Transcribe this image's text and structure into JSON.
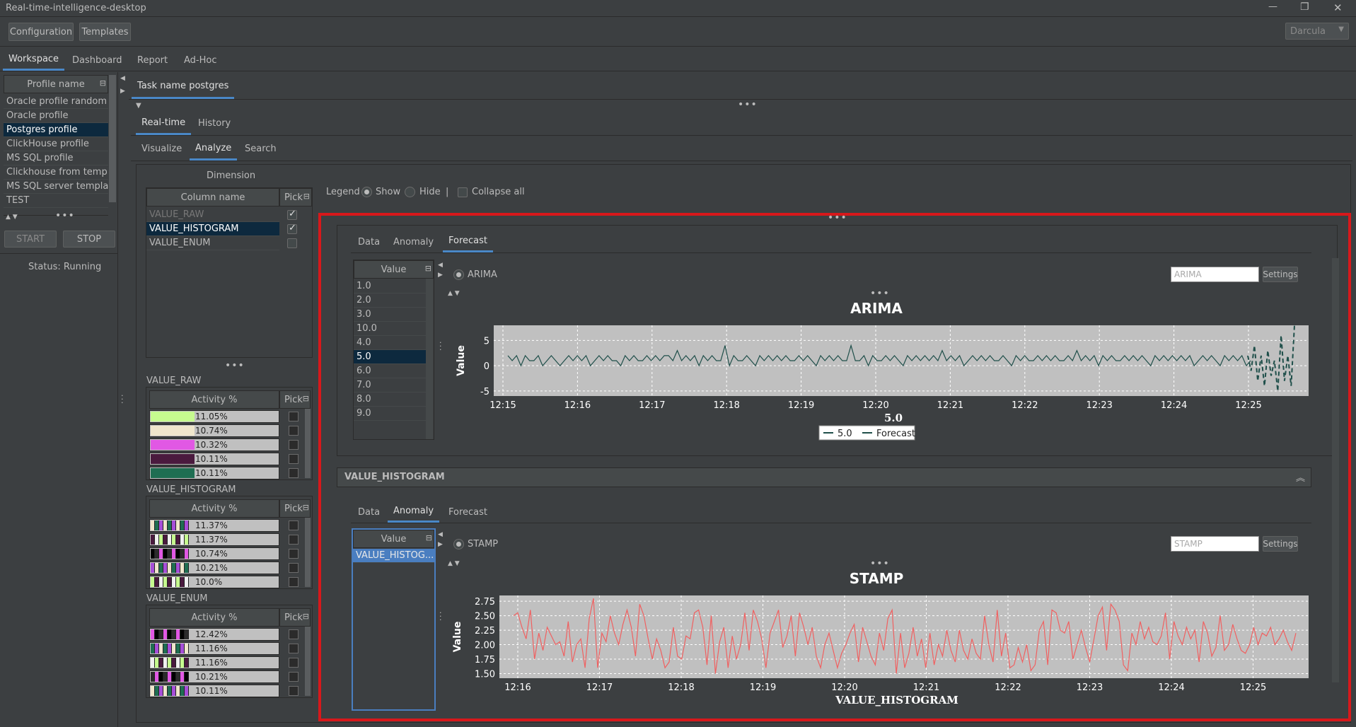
{
  "window": {
    "title": "Real-time-intelligence-desktop",
    "min": "—",
    "restore": "❐",
    "close": "✕"
  },
  "toolbar": {
    "configuration": "Configuration",
    "templates": "Templates",
    "theme": "Darcula"
  },
  "main_tabs": [
    "Workspace",
    "Dashboard",
    "Report",
    "Ad-Hoc"
  ],
  "profiles": {
    "header": "Profile name",
    "items": [
      "Oracle profile random",
      "Oracle profile",
      "Postgres profile",
      "ClickHouse profile",
      "MS SQL profile",
      "Clickhouse from templ...",
      "MS SQL server template",
      "TEST"
    ],
    "selected": 2,
    "start": "START",
    "stop": "STOP",
    "status": "Status: Running"
  },
  "task": {
    "tab": "Task name postgres",
    "mode_tabs": [
      "Real-time",
      "History"
    ],
    "sub_tabs": [
      "Visualize",
      "Analyze",
      "Search"
    ]
  },
  "dimension": {
    "title": "Dimension",
    "col_header": "Column name",
    "pick_header": "Pick",
    "columns": [
      {
        "name": "VALUE_RAW",
        "checked": true
      },
      {
        "name": "VALUE_HISTOGRAM",
        "checked": true
      },
      {
        "name": "VALUE_ENUM",
        "checked": false
      }
    ]
  },
  "activity_groups": [
    {
      "title": "VALUE_RAW",
      "header": "Activity %",
      "pick": "Pick",
      "rows": [
        {
          "pct": "11.05%",
          "color": "#c6fb8f"
        },
        {
          "pct": "10.74%",
          "color": "#efe6cc"
        },
        {
          "pct": "10.32%",
          "color": "#e158e4"
        },
        {
          "pct": "10.11%",
          "color": "#4a1a3e"
        },
        {
          "pct": "10.11%",
          "color": "#1f6e52"
        }
      ]
    },
    {
      "title": "VALUE_HISTOGRAM",
      "header": "Activity %",
      "pick": "Pick",
      "rows": [
        {
          "pct": "11.37%"
        },
        {
          "pct": "11.37%"
        },
        {
          "pct": "10.74%"
        },
        {
          "pct": "10.21%"
        },
        {
          "pct": "10.0%"
        }
      ]
    },
    {
      "title": "VALUE_ENUM",
      "header": "Activity %",
      "pick": "Pick",
      "rows": [
        {
          "pct": "12.42%"
        },
        {
          "pct": "11.16%"
        },
        {
          "pct": "11.16%"
        },
        {
          "pct": "10.21%"
        },
        {
          "pct": "10.11%"
        }
      ]
    }
  ],
  "legend": {
    "label": "Legend",
    "show": "Show",
    "hide": "Hide",
    "sep": "|",
    "collapse": "Collapse all"
  },
  "panel1": {
    "tabs": [
      "Data",
      "Anomaly",
      "Forecast"
    ],
    "active": 2,
    "value_header": "Value",
    "values": [
      "1.0",
      "2.0",
      "3.0",
      "10.0",
      "4.0",
      "5.0",
      "6.0",
      "7.0",
      "8.0",
      "9.0"
    ],
    "selected": 5,
    "method": "ARIMA",
    "input_placeholder": "ARIMA",
    "settings": "Settings"
  },
  "panel2": {
    "title": "VALUE_HISTOGRAM",
    "tabs": [
      "Data",
      "Anomaly",
      "Forecast"
    ],
    "active": 1,
    "value_header": "Value",
    "values": [
      "VALUE_HISTOG..."
    ],
    "method": "STAMP",
    "input_placeholder": "STAMP",
    "settings": "Settings"
  },
  "chart_data": [
    {
      "type": "line",
      "title": "ARIMA",
      "xlabel": "5.0",
      "ylabel": "Value",
      "x_ticks": [
        "12:15",
        "12:16",
        "12:17",
        "12:18",
        "12:19",
        "12:20",
        "12:21",
        "12:22",
        "12:23",
        "12:24",
        "12:25"
      ],
      "y_ticks": [
        "5",
        "0",
        "-5"
      ],
      "ylim": [
        -6,
        8
      ],
      "grid": true,
      "legend_position": "bottom",
      "series": [
        {
          "name": "5.0",
          "color": "#1f4f4a",
          "style": "solid",
          "values": [
            2,
            1,
            2,
            0,
            2,
            1,
            1,
            2,
            0,
            1,
            2,
            1,
            0,
            1,
            2,
            1,
            2,
            1,
            2,
            0,
            1,
            2,
            1,
            2,
            1,
            1,
            0,
            2,
            1,
            2,
            1,
            1,
            2,
            1,
            2,
            1,
            2,
            2,
            1,
            3,
            1,
            2,
            1,
            2,
            0,
            2,
            1,
            2,
            1,
            1,
            4,
            0,
            2,
            1,
            1,
            2,
            1,
            0,
            2,
            1,
            2,
            1,
            2,
            1,
            2,
            1,
            1,
            2,
            1,
            2,
            1,
            0,
            2,
            1,
            2,
            1,
            2,
            1,
            1,
            4,
            1,
            1,
            2,
            0,
            2,
            1,
            1,
            2,
            1,
            2,
            1,
            0,
            2,
            1,
            2,
            1,
            2,
            1,
            2,
            1,
            3,
            1,
            2,
            1,
            2,
            0,
            1,
            2,
            1,
            2,
            1,
            2,
            1,
            1,
            2,
            1,
            0,
            2,
            1,
            2,
            1,
            1,
            2,
            1,
            2,
            1,
            2,
            1,
            1,
            2,
            1,
            3,
            1,
            2,
            1,
            2,
            0,
            2,
            1,
            2,
            1,
            1,
            2,
            1,
            2,
            1,
            2,
            1,
            0,
            2,
            1,
            2,
            1,
            2,
            1,
            2,
            1,
            2,
            0,
            1,
            2,
            1,
            2,
            1,
            0,
            2,
            1,
            2,
            1,
            2,
            0,
            1
          ]
        },
        {
          "name": "Forecast",
          "color": "#1f4f4a",
          "style": "dashed",
          "values": [
            2,
            -1,
            4,
            -3,
            2,
            -4,
            3,
            -2,
            1,
            -5,
            6,
            -3,
            2,
            -4,
            8
          ]
        }
      ]
    },
    {
      "type": "line",
      "title": "STAMP",
      "xlabel": "VALUE_HISTOGRAM",
      "ylabel": "Value",
      "x_ticks": [
        "12:16",
        "12:17",
        "12:18",
        "12:19",
        "12:20",
        "12:21",
        "12:22",
        "12:23",
        "12:24",
        "12:25"
      ],
      "y_ticks": [
        "2.75",
        "2.50",
        "2.25",
        "2.00",
        "1.75",
        "1.50"
      ],
      "ylim": [
        1.42,
        2.85
      ],
      "grid": true,
      "series": [
        {
          "name": "",
          "color": "#f06060",
          "values": [
            2.5,
            2.55,
            2.3,
            2.1,
            2.6,
            1.75,
            2.2,
            1.9,
            2.3,
            2.15,
            2.0,
            2.05,
            1.8,
            2.4,
            1.7,
            2.0,
            2.1,
            1.6,
            2.45,
            2.8,
            1.6,
            2.2,
            2.05,
            2.5,
            2.2,
            2.0,
            2.35,
            2.6,
            2.3,
            1.8,
            2.7,
            2.5,
            2.1,
            1.75,
            2.1,
            1.9,
            1.6,
            1.7,
            2.3,
            1.8,
            1.75,
            2.15,
            2.1,
            2.55,
            2.6,
            2.3,
            1.65,
            2.5,
            1.5,
            2.05,
            2.3,
            1.6,
            2.15,
            1.75,
            2.0,
            2.55,
            1.9,
            2.6,
            2.4,
            2.1,
            1.6,
            2.2,
            2.4,
            2.6,
            1.95,
            2.15,
            2.5,
            1.8,
            2.55,
            2.3,
            2.0,
            2.3,
            1.8,
            1.6,
            2.0,
            2.2,
            1.9,
            1.6,
            1.85,
            2.0,
            2.2,
            2.35,
            1.7,
            2.3,
            2.05,
            1.8,
            1.65,
            2.2,
            1.9,
            2.45,
            2.6,
            1.5,
            2.2,
            1.6,
            1.85,
            2.3,
            1.8,
            2.1,
            1.6,
            2.2,
            1.65,
            2.0,
            1.8,
            2.25,
            1.9,
            1.7,
            2.25,
            1.9,
            1.75,
            2.1,
            1.85,
            1.75,
            2.5,
            2.0,
            1.7,
            2.6,
            1.8,
            2.2,
            1.6,
            1.65,
            1.95,
            1.7,
            2.0,
            1.55,
            1.65,
            2.25,
            2.4,
            1.65,
            2.6,
            2.55,
            2.25,
            2.2,
            2.4,
            1.75,
            2.0,
            2.25,
            1.95,
            1.7,
            2.1,
            2.5,
            2.65,
            1.9,
            2.7,
            2.6,
            2.4,
            1.65,
            1.55,
            2.2,
            2.0,
            2.4,
            2.1,
            2.3,
            2.05,
            2.0,
            2.15,
            2.55,
            1.75,
            2.4,
            2.15,
            2.0,
            2.3,
            2.1,
            2.25,
            1.7,
            2.4,
            2.2,
            1.8,
            1.95,
            2.5,
            1.9,
            2.0,
            2.35,
            2.1,
            1.9,
            1.85,
            2.0,
            2.3,
            2.0,
            2.2,
            2.15,
            2.3,
            2.0,
            2.1,
            2.25,
            2.05,
            1.9,
            2.2
          ]
        }
      ]
    }
  ]
}
